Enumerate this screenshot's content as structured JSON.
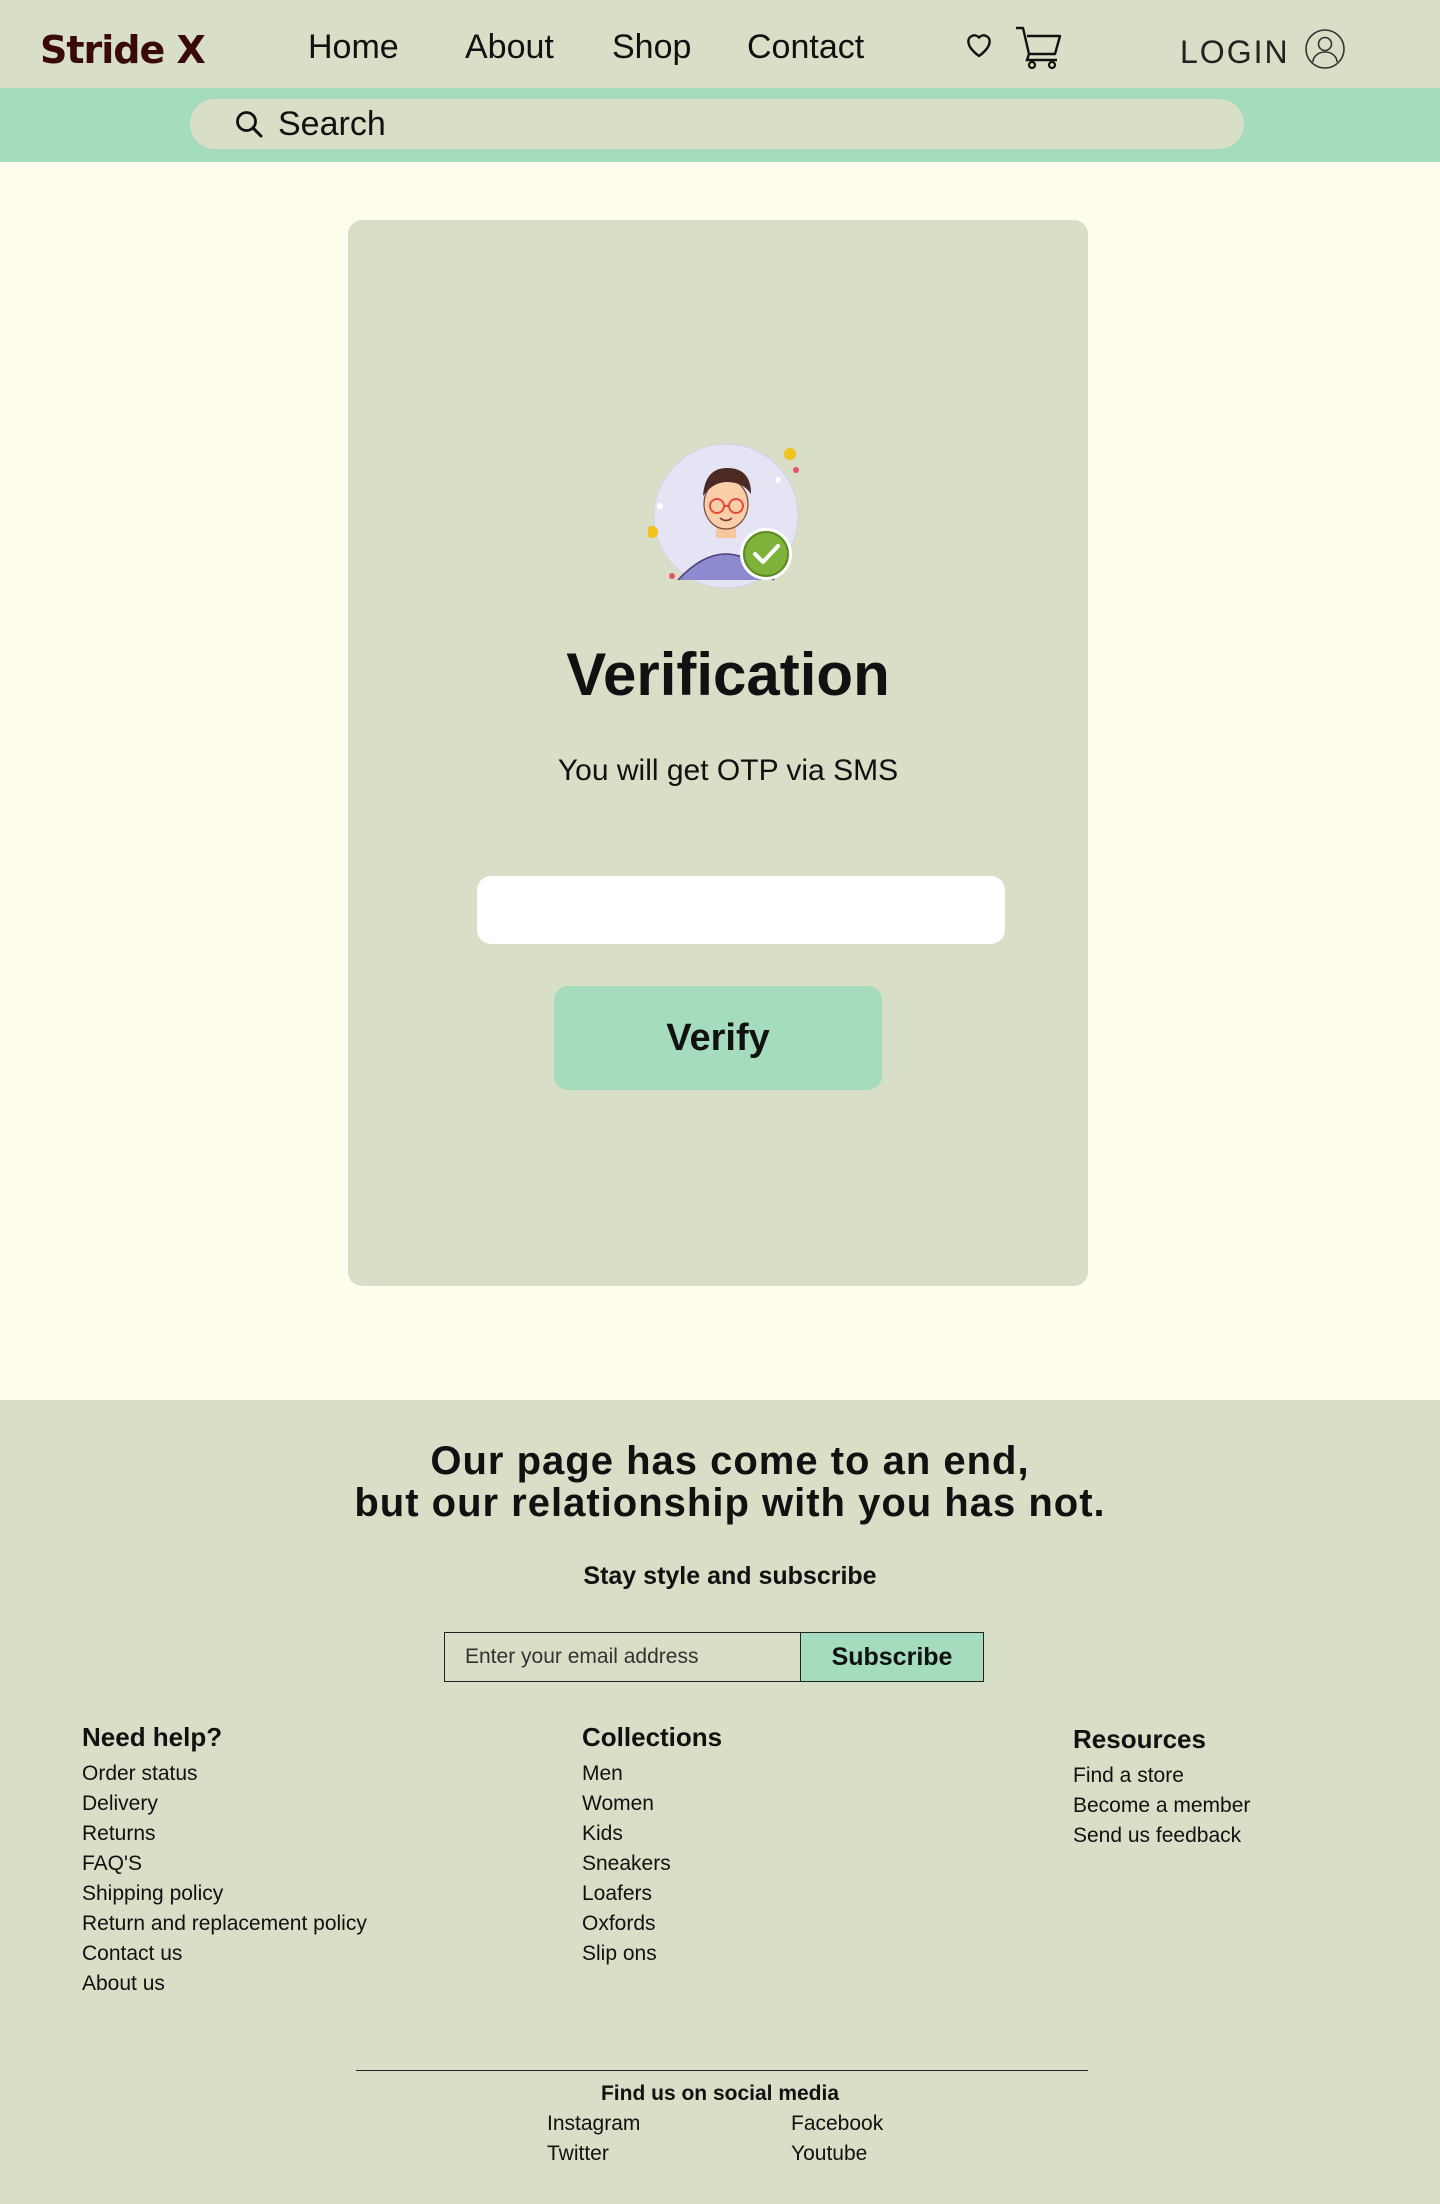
{
  "header": {
    "logo": "Stride X",
    "nav": [
      "Home",
      "About",
      "Shop",
      "Contact"
    ],
    "login_label": "LOGIN",
    "icons": [
      "heart-icon",
      "cart-icon",
      "user-icon"
    ]
  },
  "search": {
    "label": "Search"
  },
  "verification": {
    "title": "Verification",
    "subtitle": "You will get OTP via SMS",
    "otp_value": "",
    "button_label": "Verify"
  },
  "footer": {
    "headline_line1": "Our page has come to an end,",
    "headline_line2": "but our relationship with you has not.",
    "subscribe_prompt": "Stay style and subscribe",
    "email_placeholder": "Enter your email address",
    "subscribe_label": "Subscribe",
    "columns": [
      {
        "title": "Need help?",
        "links": [
          "Order status",
          "Delivery",
          "Returns",
          "FAQ'S",
          "Shipping policy",
          "Return and replacement policy",
          "Contact us",
          "About us"
        ]
      },
      {
        "title": "Collections",
        "links": [
          "Men",
          "Women",
          "Kids",
          "Sneakers",
          "Loafers",
          "Oxfords",
          "Slip ons"
        ]
      },
      {
        "title": "Resources",
        "links": [
          "Find a store",
          "Become a member",
          "Send us feedback"
        ]
      }
    ],
    "social_title": "Find us on social media",
    "social_links": [
      "Instagram",
      "Facebook",
      "Twitter",
      "Youtube"
    ]
  },
  "colors": {
    "header_bg": "#d9dec7",
    "accent_mint": "#a4dcbd",
    "page_bg": "#fffdee",
    "logo": "#3a0a0a"
  }
}
